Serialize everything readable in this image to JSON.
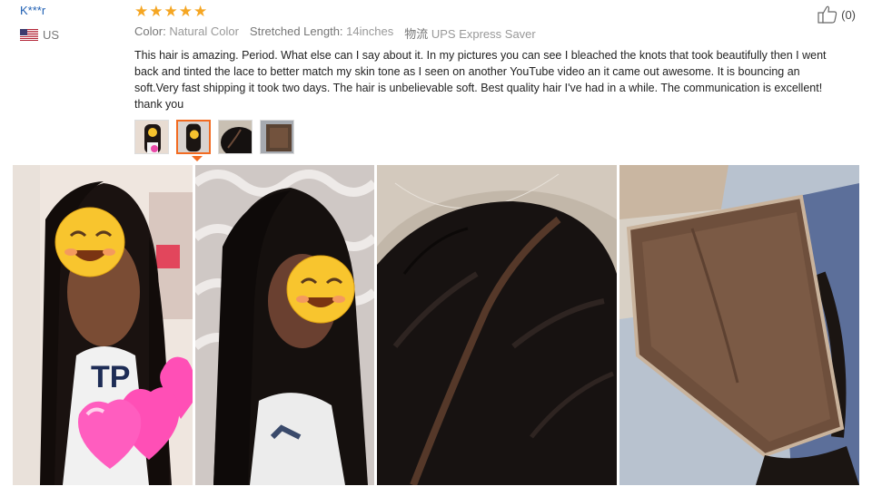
{
  "reviewer": {
    "name": "K***r",
    "country": "US",
    "flag_icon": "us-flag-icon"
  },
  "rating": {
    "stars": 5,
    "star_color": "#f5a623"
  },
  "properties": [
    {
      "key": "Color:",
      "value": "Natural Color"
    },
    {
      "key": "Stretched Length:",
      "value": "14inches"
    },
    {
      "key": "物流",
      "value": "UPS Express Saver"
    }
  ],
  "helpful": {
    "icon": "thumbs-up-icon",
    "count": "(0)"
  },
  "review_text": "This hair is amazing. Period. What else can I say about it. In my pictures you can see I bleached the knots that took beautifully then I went back and tinted the lace to better match my skin tone as I seen on another YouTube video an it came out awesome. It is bouncing an soft.Very fast shipping it took two days. The hair is unbelievable soft. Best quality hair I've had in a while. The communication is excellent! thank you",
  "thumbnails": {
    "count": 4,
    "selected_index": 1,
    "selected_color": "#f26b21"
  },
  "photos": {
    "count": 4
  },
  "colors": {
    "link": "#1f5fb3",
    "accent": "#f26b21"
  }
}
